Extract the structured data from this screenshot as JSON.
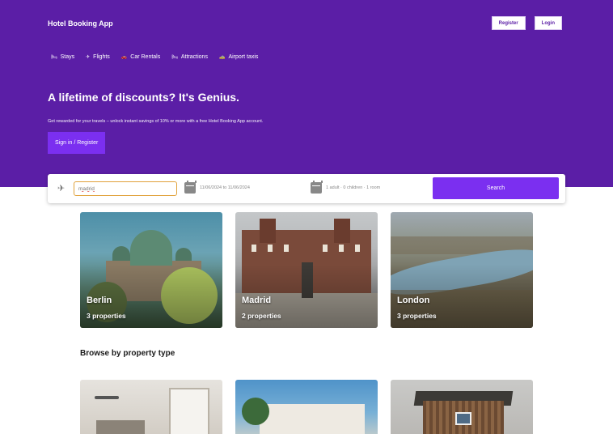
{
  "header": {
    "brand": "Hotel Booking App",
    "register_label": "Register",
    "login_label": "Login"
  },
  "nav": {
    "items": [
      {
        "icon": "bed-icon",
        "label": "Stays"
      },
      {
        "icon": "plane-icon",
        "label": "Flights"
      },
      {
        "icon": "car-icon",
        "label": "Car Rentals"
      },
      {
        "icon": "bed-icon",
        "label": "Attractions"
      },
      {
        "icon": "taxi-icon",
        "label": "Airport taxis"
      }
    ]
  },
  "hero": {
    "headline": "A lifetime of discounts? It's Genius.",
    "subline": "Get rewarded for your travels – unlock instant savings of 10% or more with a free Hotel Booking App account.",
    "signin_label": "Sign in / Register"
  },
  "search": {
    "destination_value": "madrid",
    "dates": "11/06/2024 to 11/06/2024",
    "guests": "1 adult · 0 children · 1 room",
    "search_label": "Search"
  },
  "cities": [
    {
      "name": "Berlin",
      "count": "3 properties"
    },
    {
      "name": "Madrid",
      "count": "2 properties"
    },
    {
      "name": "London",
      "count": "3 properties"
    }
  ],
  "property_types": {
    "title": "Browse by property type"
  },
  "colors": {
    "brand_purple": "#5b1ea6",
    "accent_purple": "#7b2ff0"
  }
}
